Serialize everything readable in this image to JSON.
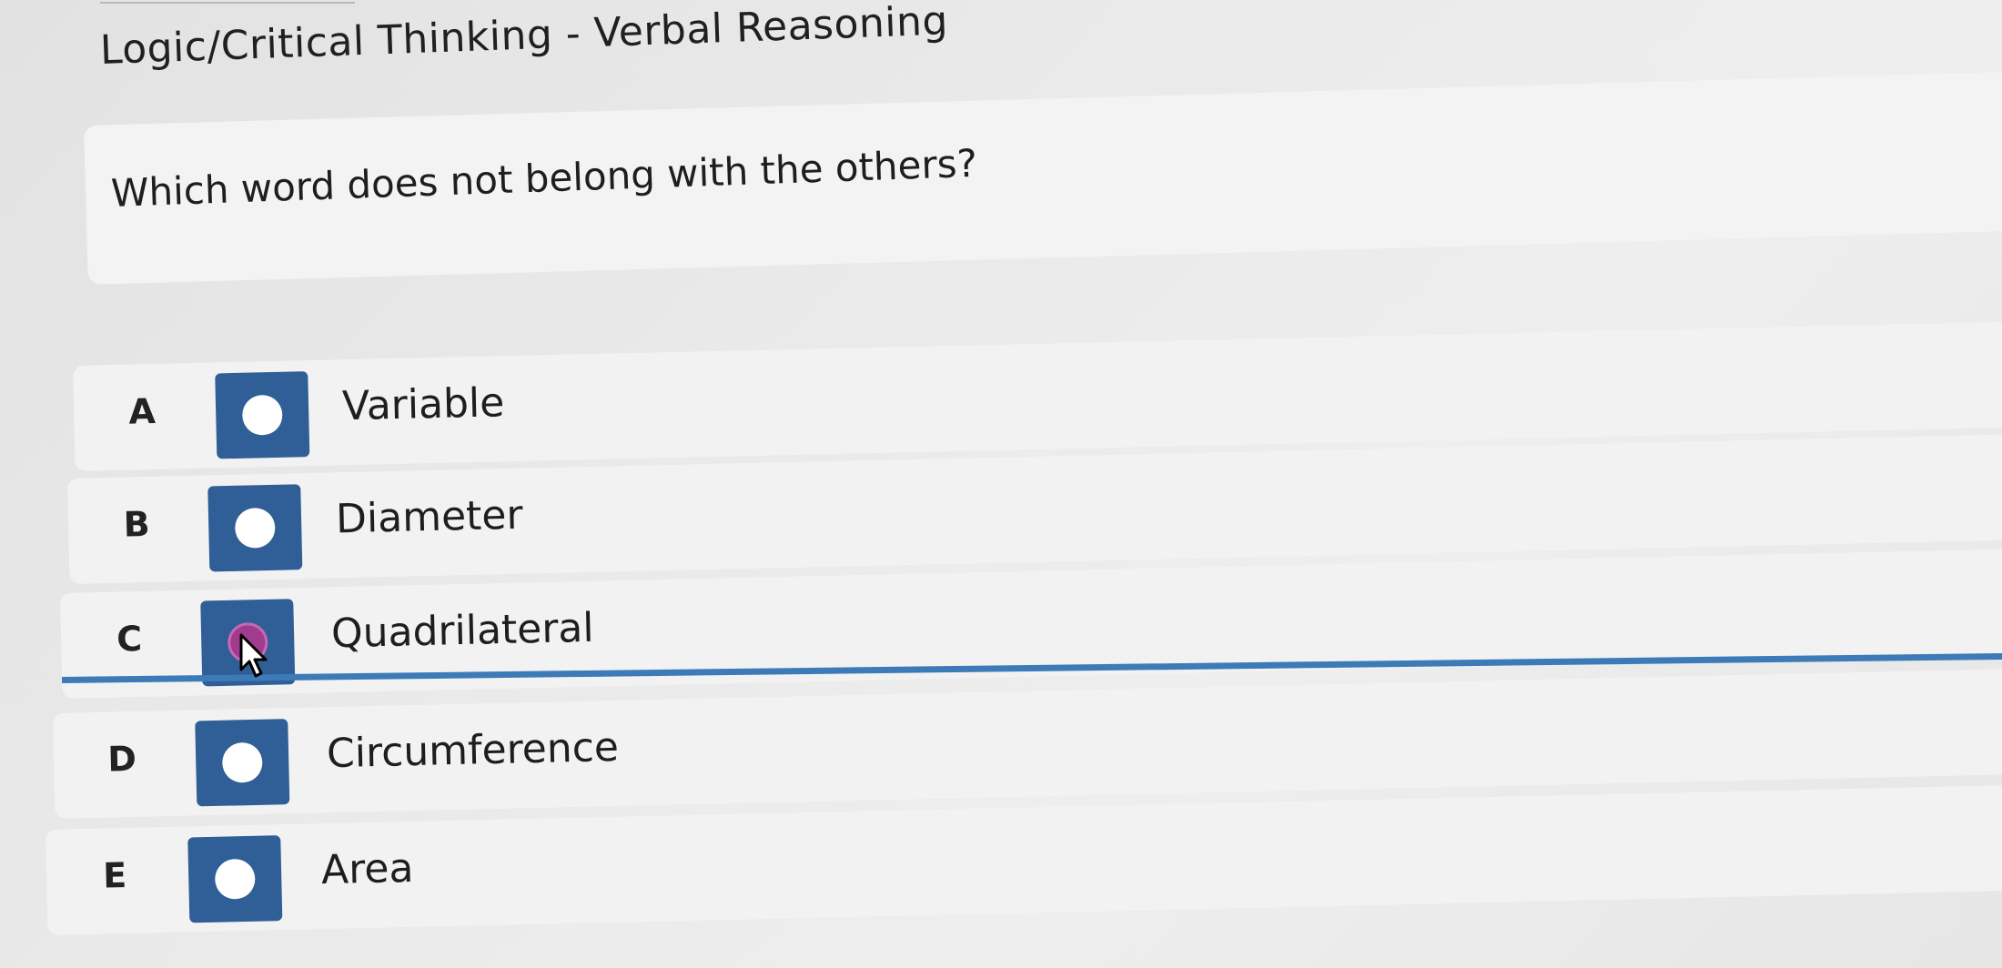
{
  "header": {
    "title": "Logic/Critical Thinking - Verbal Reasoning"
  },
  "question": {
    "text": "Which word does not belong with the others?"
  },
  "options": [
    {
      "letter": "A",
      "label": "Variable",
      "selected": false
    },
    {
      "letter": "B",
      "label": "Diameter",
      "selected": false
    },
    {
      "letter": "C",
      "label": "Quadrilateral",
      "selected": true
    },
    {
      "letter": "D",
      "label": "Circumference",
      "selected": false
    },
    {
      "letter": "E",
      "label": "Area",
      "selected": false
    }
  ],
  "colors": {
    "radio_bg": "#2f5f96",
    "selected_dot": "#a03b8e",
    "selection_line": "#3d7ab8"
  },
  "icons": {
    "cursor": "mouse-pointer-icon"
  }
}
